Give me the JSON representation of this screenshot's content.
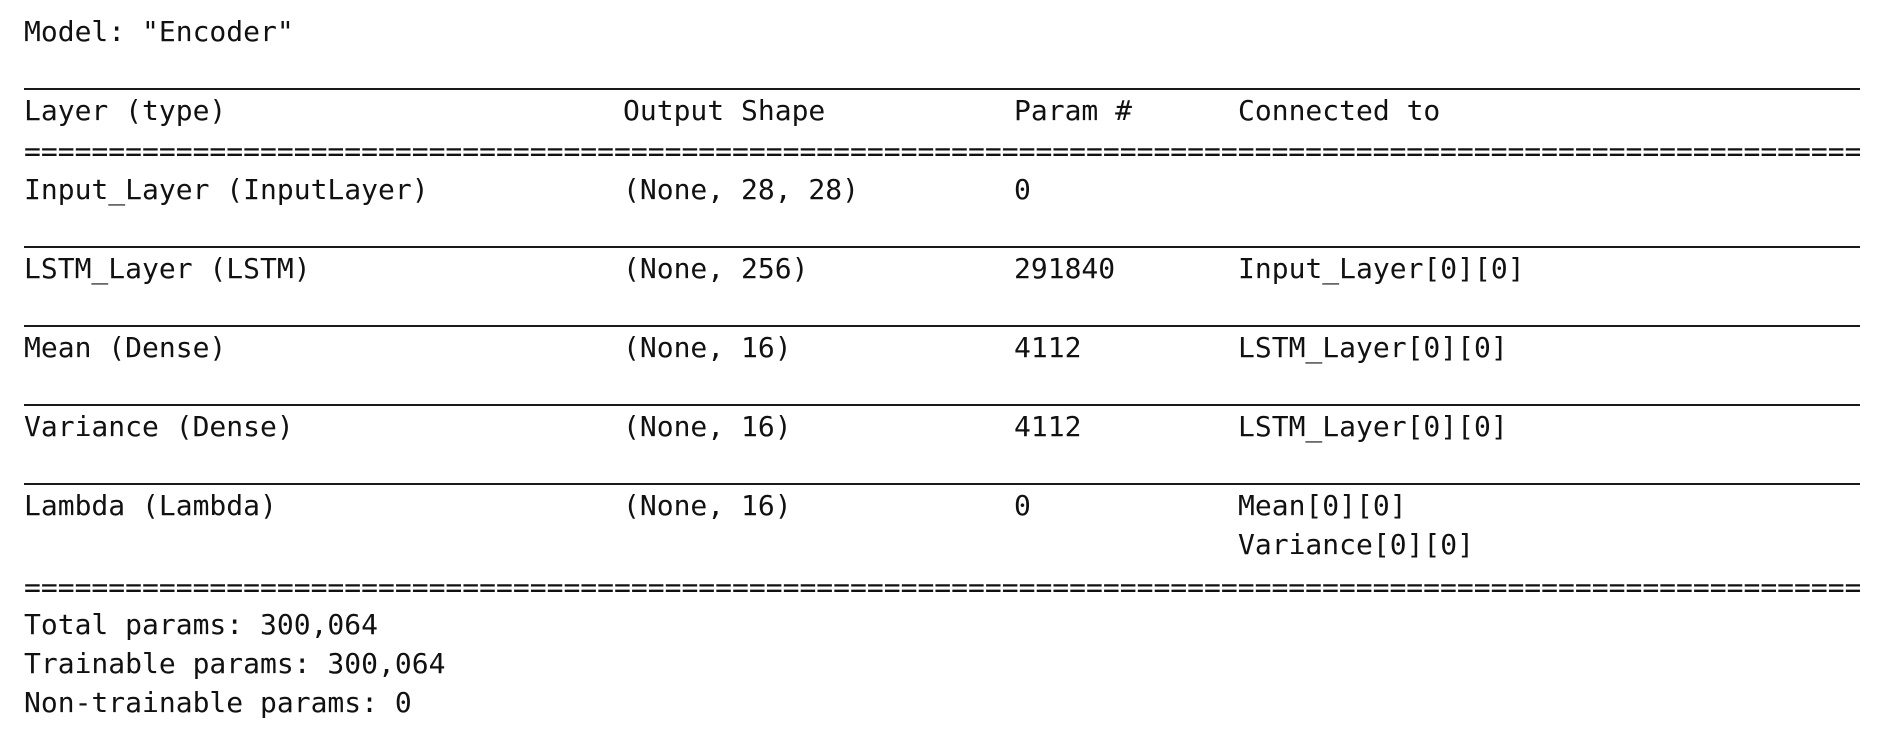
{
  "model_title": "Model: \"Encoder\"",
  "header": {
    "layer": "Layer (type)",
    "output_shape": "Output Shape",
    "param": "Param #",
    "connected_to": "Connected to"
  },
  "rows": [
    {
      "layer": "Input_Layer (InputLayer)",
      "output_shape": "(None, 28, 28)",
      "param": "0",
      "connected_to": [
        ""
      ]
    },
    {
      "layer": "LSTM_Layer (LSTM)",
      "output_shape": "(None, 256)",
      "param": "291840",
      "connected_to": [
        "Input_Layer[0][0]"
      ]
    },
    {
      "layer": "Mean (Dense)",
      "output_shape": "(None, 16)",
      "param": "4112",
      "connected_to": [
        "LSTM_Layer[0][0]"
      ]
    },
    {
      "layer": "Variance (Dense)",
      "output_shape": "(None, 16)",
      "param": "4112",
      "connected_to": [
        "LSTM_Layer[0][0]"
      ]
    },
    {
      "layer": "Lambda (Lambda)",
      "output_shape": "(None, 16)",
      "param": "0",
      "connected_to": [
        "Mean[0][0]",
        "Variance[0][0]"
      ]
    }
  ],
  "summary": {
    "total": "Total params: 300,064",
    "trainable": "Trainable params: 300,064",
    "non_trainable": "Non-trainable params: 0"
  }
}
